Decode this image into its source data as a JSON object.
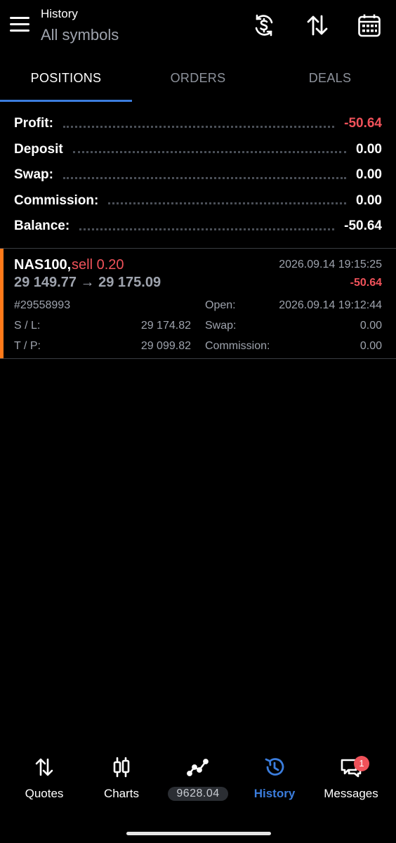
{
  "header": {
    "title": "History",
    "subtitle": "All symbols",
    "icons": [
      "menu-icon",
      "currency-sync-icon",
      "sort-icon",
      "calendar-icon"
    ]
  },
  "tabs": [
    {
      "label": "POSITIONS",
      "active": true
    },
    {
      "label": "ORDERS",
      "active": false
    },
    {
      "label": "DEALS",
      "active": false
    }
  ],
  "summary": [
    {
      "label": "Profit:",
      "value": "-50.64",
      "negative": true
    },
    {
      "label": "Deposit",
      "value": "0.00",
      "negative": false
    },
    {
      "label": "Swap:",
      "value": "0.00",
      "negative": false
    },
    {
      "label": "Commission:",
      "value": "0.00",
      "negative": false
    },
    {
      "label": "Balance:",
      "value": "-50.64",
      "negative": false
    }
  ],
  "position": {
    "symbol": "NAS100,",
    "side": "sell 0.20",
    "close_time": "2026.09.14 19:15:25",
    "prices": "29 149.77 → 29 175.09",
    "profit": "-50.64",
    "ticket": "#29558993",
    "open_label": "Open:",
    "open_time": "2026.09.14 19:12:44",
    "sl_label": "S / L:",
    "sl_value": "29 174.82",
    "swap_label": "Swap:",
    "swap_value": "0.00",
    "tp_label": "T / P:",
    "tp_value": "29 099.82",
    "commission_label": "Commission:",
    "commission_value": "0.00",
    "accent_color": "#ff7a1a"
  },
  "bottom_nav": {
    "items": [
      {
        "label": "Quotes",
        "icon": "quotes-icon",
        "active": false
      },
      {
        "label": "Charts",
        "icon": "candlestick-icon",
        "active": false
      },
      {
        "label": "9628.04",
        "icon": "trade-line-icon",
        "active": false
      },
      {
        "label": "History",
        "icon": "history-icon",
        "active": true
      },
      {
        "label": "Messages",
        "icon": "messages-icon",
        "active": false,
        "badge": "1"
      }
    ]
  },
  "colors": {
    "accent": "#3b7ddd",
    "negative": "#f0525a",
    "muted": "#9ea3ad"
  }
}
